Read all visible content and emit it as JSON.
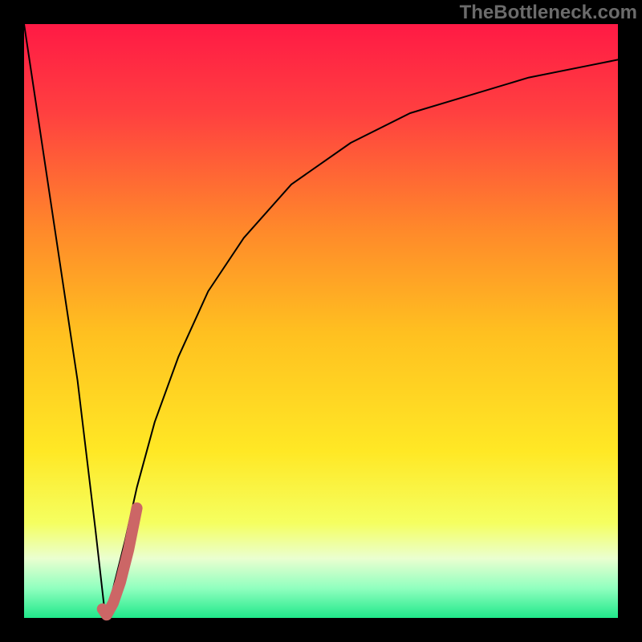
{
  "watermark": "TheBottleneck.com",
  "colors": {
    "frame": "#000000",
    "curve": "#000000",
    "highlight": "#cc6666",
    "gradient_stops": [
      {
        "pct": 0,
        "color": "#ff1a45"
      },
      {
        "pct": 15,
        "color": "#ff4040"
      },
      {
        "pct": 35,
        "color": "#ff8a2a"
      },
      {
        "pct": 52,
        "color": "#ffc020"
      },
      {
        "pct": 72,
        "color": "#ffe825"
      },
      {
        "pct": 84,
        "color": "#f5ff60"
      },
      {
        "pct": 90,
        "color": "#eaffd0"
      },
      {
        "pct": 95,
        "color": "#90ffbf"
      },
      {
        "pct": 100,
        "color": "#20e88a"
      }
    ]
  },
  "chart_data": {
    "type": "line",
    "title": "",
    "xlabel": "",
    "ylabel": "",
    "xlim": [
      0,
      100
    ],
    "ylim": [
      0,
      100
    ],
    "series": [
      {
        "name": "bottleneck-curve",
        "x": [
          0,
          3,
          6,
          9,
          12,
          13.7,
          15,
          17,
          19,
          22,
          26,
          31,
          37,
          45,
          55,
          65,
          75,
          85,
          95,
          100
        ],
        "y": [
          100,
          80,
          60,
          40,
          15,
          0,
          5,
          13,
          22,
          33,
          44,
          55,
          64,
          73,
          80,
          85,
          88,
          91,
          93,
          94
        ]
      },
      {
        "name": "highlight-segment",
        "x": [
          13.2,
          13.9,
          15.0,
          16.2,
          17.6,
          19.0
        ],
        "y": [
          1.5,
          0.5,
          2.5,
          6.0,
          11.5,
          18.5
        ]
      }
    ],
    "minimum": {
      "x": 13.7,
      "y": 0
    }
  }
}
